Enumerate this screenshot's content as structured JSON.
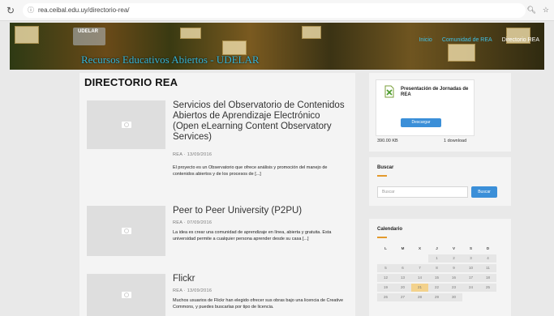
{
  "browser": {
    "url": "rea.ceibal.edu.uy/directorio-rea/",
    "icons": [
      "reload-icon",
      "zoom-icon",
      "star-icon"
    ]
  },
  "banner": {
    "logo_text": "UDELAR",
    "site_title": "Recursos Educativos Abiertos - UDELAR",
    "nav": [
      "Inicio",
      "Comunidad de REA",
      "Directorio REA"
    ]
  },
  "main": {
    "page_title": "DIRECTORIO REA",
    "posts": [
      {
        "title": "Servicios del Observatorio de Contenidos Abiertos de Aprendizaje Electrónico (Open eLearning Content Observatory Services)",
        "date": "REA · 13/09/2016",
        "excerpt": "El proyecto es un Observatorio que ofrece análisis y promoción del manejo de contenidos abiertos y de los procesos de [...]"
      },
      {
        "title": "Peer to Peer University (P2PU)",
        "date": "REA · 07/09/2016",
        "excerpt": "La idea es crear una comunidad de aprendizaje en línea, abierta y gratuita. Esta universidad permite a cualquier persona aprender desde su casa [...]"
      },
      {
        "title": "Flickr",
        "date": "REA · 13/09/2016",
        "excerpt": "Muchos usuarios de Flickr han elegido ofrecer sus obras bajo una licencia de Creative Commons, y puedes buscarlas por tipo de licencia."
      }
    ]
  },
  "sidebar": {
    "download": {
      "title": "Presentación de Jornadas de REA",
      "button": "Descargar",
      "size": "390.00 KB",
      "downloads": "1 download"
    },
    "search": {
      "title": "Buscar",
      "placeholder": "Buscar",
      "button": "Buscar"
    },
    "calendar": {
      "title": "Calendario",
      "weekdays": [
        "L",
        "M",
        "X",
        "J",
        "V",
        "S",
        "D"
      ],
      "weeks": [
        [
          "",
          "",
          "",
          "1",
          "2",
          "3",
          "4"
        ],
        [
          "5",
          "6",
          "7",
          "8",
          "9",
          "10",
          "11"
        ],
        [
          "12",
          "13",
          "14",
          "15",
          "16",
          "17",
          "18"
        ],
        [
          "19",
          "20",
          "21",
          "22",
          "23",
          "24",
          "25"
        ],
        [
          "26",
          "27",
          "28",
          "29",
          "30",
          "",
          ""
        ]
      ],
      "today": "21"
    }
  }
}
